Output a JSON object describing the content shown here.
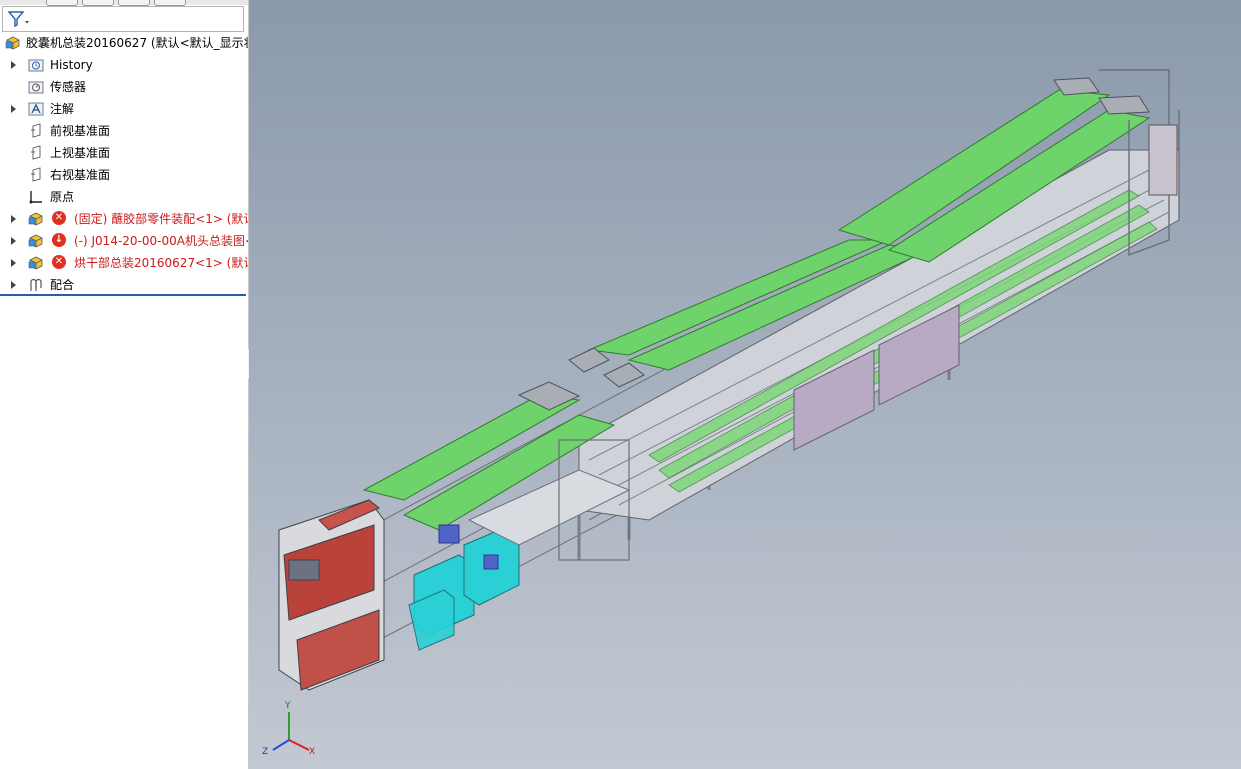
{
  "feature_tree": {
    "root": {
      "label": "胶囊机总装20160627 (默认<默认_显示状"
    },
    "items": [
      {
        "label": "History",
        "icon": "history-folder-icon",
        "expandable": true,
        "status": ""
      },
      {
        "label": "传感器",
        "icon": "sensor-icon",
        "expandable": false,
        "status": ""
      },
      {
        "label": "注解",
        "icon": "annotation-icon",
        "expandable": true,
        "status": ""
      },
      {
        "label": "前视基准面",
        "icon": "plane-icon",
        "expandable": false,
        "status": ""
      },
      {
        "label": "上视基准面",
        "icon": "plane-icon",
        "expandable": false,
        "status": ""
      },
      {
        "label": "右视基准面",
        "icon": "plane-icon",
        "expandable": false,
        "status": ""
      },
      {
        "label": "原点",
        "icon": "origin-icon",
        "expandable": false,
        "status": ""
      },
      {
        "label": "(固定) 蘸胶部零件装配<1> (默认",
        "icon": "assembly-icon",
        "expandable": true,
        "status": "error"
      },
      {
        "label": "(-) J014-20-00-00A机头总装图<",
        "icon": "assembly-icon",
        "expandable": true,
        "status": "warning"
      },
      {
        "label": "烘干部总装20160627<1> (默认",
        "icon": "assembly-icon",
        "expandable": true,
        "status": "error"
      },
      {
        "label": "配合",
        "icon": "mates-icon",
        "expandable": true,
        "status": ""
      }
    ]
  },
  "colors": {
    "selection_line": "#2a5ca8",
    "error": "#e03020",
    "error_text": "#cc1a1a",
    "viewport_top": "#8b99ac",
    "viewport_bottom": "#c3c9d2",
    "cover_green": "#6fd36c",
    "frame_grey": "#c9ccd2",
    "cabinet_purple": "#b8a9c4",
    "machine_cyan": "#2ad0d6"
  },
  "triad": {
    "x": "X",
    "y": "Y",
    "z": "Z"
  }
}
